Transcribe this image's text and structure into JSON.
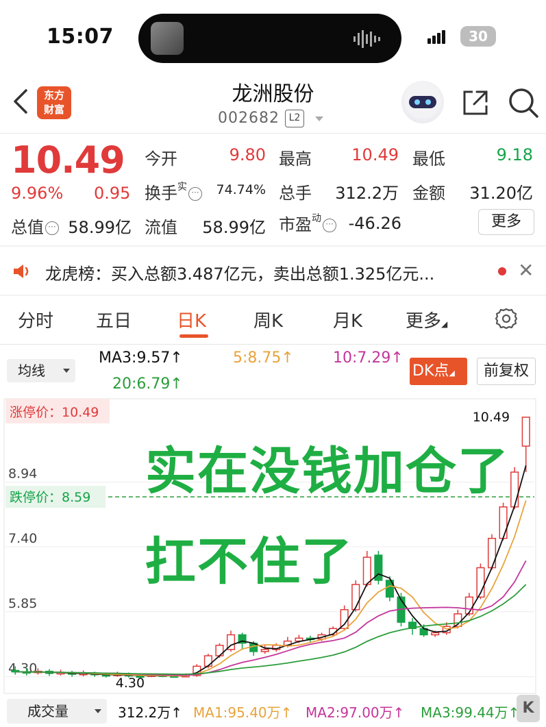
{
  "status_bar": {
    "time": "15:07",
    "battery": "30"
  },
  "header": {
    "brand": [
      "东方",
      "财富"
    ],
    "stock_name": "龙洲股份",
    "stock_code": "002682",
    "level_badge": "L2"
  },
  "quote": {
    "price": "10.49",
    "change_pct": "9.96%",
    "change_amt": "0.95",
    "fields": {
      "open_label": "今开",
      "open_value": "9.80",
      "high_label": "最高",
      "high_value": "10.49",
      "low_label": "最低",
      "low_value": "9.18",
      "turnover_label": "换手",
      "turnover_sup": "实",
      "turnover_value": "74.74%",
      "volume_label": "总手",
      "volume_value": "312.2万",
      "amount_label": "金额",
      "amount_value": "31.20亿",
      "total_cap_label": "总值",
      "total_cap_value": "58.99亿",
      "float_cap_label": "流值",
      "float_cap_value": "58.99亿",
      "pe_label": "市盈",
      "pe_sup": "动",
      "pe_value": "-46.26"
    },
    "more_label": "更多"
  },
  "news": {
    "text": "龙虎榜：买入总额3.487亿元，卖出总额1.325亿元..."
  },
  "tabs": [
    "分时",
    "五日",
    "日K",
    "周K",
    "月K",
    "更多"
  ],
  "ma_bar": {
    "selector": "均线",
    "ma3": "MA3:9.57↑",
    "ma5": "5:8.75↑",
    "ma10": "10:7.29↑",
    "ma20": "20:6.79↑",
    "dk_label": "DK点",
    "adjust_label": "前复权"
  },
  "chart": {
    "limit_up_label": "涨停价：10.49",
    "limit_down_label": "跌停价：8.59",
    "axis_labels": [
      "8.94",
      "7.40",
      "5.85",
      "4.30"
    ],
    "high_marker": "10.49",
    "low_marker": "4.30",
    "overlay_line1": "实在没钱加仓了",
    "overlay_line2": "扛不住了"
  },
  "chart_data": {
    "type": "candlestick",
    "y_ticks": [
      4.3,
      5.85,
      7.4,
      8.94
    ],
    "ylim": [
      4.0,
      10.7
    ],
    "limit_up": 10.49,
    "limit_down": 8.59,
    "candles": [
      [
        4.45,
        4.42,
        4.55,
        4.35
      ],
      [
        4.42,
        4.4,
        4.5,
        4.33
      ],
      [
        4.4,
        4.43,
        4.5,
        4.35
      ],
      [
        4.43,
        4.38,
        4.48,
        4.32
      ],
      [
        4.38,
        4.4,
        4.47,
        4.33
      ],
      [
        4.4,
        4.36,
        4.44,
        4.3
      ],
      [
        4.36,
        4.38,
        4.45,
        4.31
      ],
      [
        4.38,
        4.35,
        4.42,
        4.3
      ],
      [
        4.35,
        4.33,
        4.4,
        4.28
      ],
      [
        4.33,
        4.36,
        4.42,
        4.3
      ],
      [
        4.36,
        4.32,
        4.4,
        4.28
      ],
      [
        4.32,
        4.31,
        4.36,
        4.28
      ],
      [
        4.31,
        4.34,
        4.38,
        4.29
      ],
      [
        4.34,
        4.32,
        4.37,
        4.29
      ],
      [
        4.32,
        4.31,
        4.35,
        4.28
      ],
      [
        4.31,
        4.33,
        4.38,
        4.3
      ],
      [
        4.33,
        4.55,
        4.6,
        4.3
      ],
      [
        4.55,
        4.8,
        4.85,
        4.5
      ],
      [
        4.8,
        5.05,
        5.1,
        4.75
      ],
      [
        4.95,
        5.3,
        5.4,
        4.9
      ],
      [
        5.3,
        5.1,
        5.35,
        4.95
      ],
      [
        5.1,
        4.9,
        5.15,
        4.8
      ],
      [
        4.9,
        4.95,
        5.05,
        4.85
      ],
      [
        4.95,
        5.05,
        5.1,
        4.9
      ],
      [
        5.05,
        5.15,
        5.25,
        5.0
      ],
      [
        5.15,
        5.22,
        5.3,
        5.1
      ],
      [
        5.22,
        5.2,
        5.28,
        5.12
      ],
      [
        5.2,
        5.3,
        5.35,
        5.15
      ],
      [
        5.3,
        5.45,
        5.5,
        5.25
      ],
      [
        5.45,
        5.9,
        6.0,
        5.4
      ],
      [
        5.9,
        6.5,
        6.6,
        5.85
      ],
      [
        6.5,
        7.15,
        7.3,
        6.45
      ],
      [
        7.2,
        6.6,
        7.3,
        6.5
      ],
      [
        6.6,
        6.2,
        6.7,
        6.1
      ],
      [
        6.2,
        5.6,
        6.3,
        5.5
      ],
      [
        5.6,
        5.45,
        5.7,
        5.3
      ],
      [
        5.45,
        5.3,
        5.55,
        5.25
      ],
      [
        5.3,
        5.35,
        5.4,
        5.25
      ],
      [
        5.35,
        5.5,
        5.6,
        5.3
      ],
      [
        5.5,
        5.8,
        5.9,
        5.45
      ],
      [
        5.8,
        6.2,
        6.3,
        5.75
      ],
      [
        6.2,
        6.9,
        7.0,
        6.15
      ],
      [
        6.9,
        7.6,
        7.7,
        6.85
      ],
      [
        7.6,
        8.35,
        8.45,
        7.55
      ],
      [
        8.35,
        9.18,
        9.3,
        8.3
      ],
      [
        9.8,
        10.49,
        10.49,
        9.18
      ]
    ],
    "ma": [
      {
        "name": "MA3",
        "color": "#111111",
        "last": 9.57
      },
      {
        "name": "MA5",
        "color": "#e8a33a",
        "last": 8.75
      },
      {
        "name": "MA10",
        "color": "#c4359b",
        "last": 7.29
      },
      {
        "name": "MA20",
        "color": "#2a9d3a",
        "last": 6.79
      }
    ]
  },
  "volume_bar": {
    "selector": "成交量",
    "total": "312.2万↑",
    "ma1": "MA1:95.40万↑",
    "ma2": "MA2:97.00万↑",
    "ma3": "MA3:99.44万↑",
    "k_button": "K"
  }
}
